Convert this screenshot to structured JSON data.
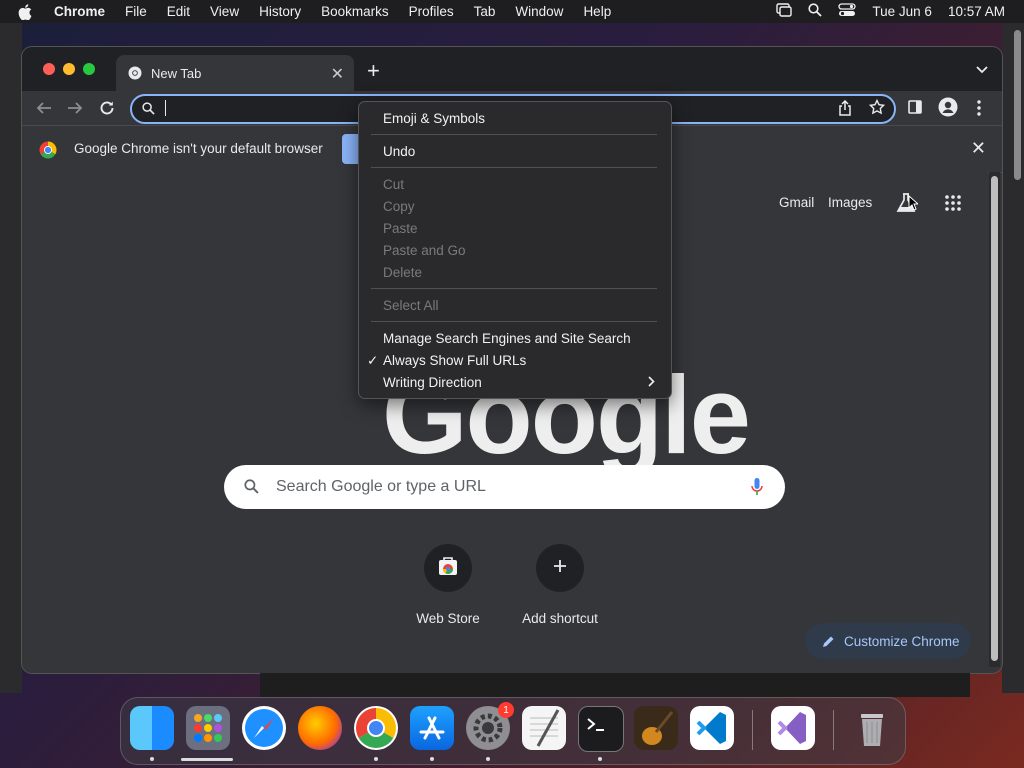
{
  "menubar": {
    "app_name": "Chrome",
    "items": [
      "File",
      "Edit",
      "View",
      "History",
      "Bookmarks",
      "Profiles",
      "Tab",
      "Window",
      "Help"
    ],
    "date": "Tue Jun 6",
    "time": "10:57 AM"
  },
  "tab": {
    "title": "New Tab"
  },
  "omnibox": {
    "value": ""
  },
  "infobar": {
    "message": "Google Chrome isn't your default browser"
  },
  "ntp": {
    "links": [
      "Gmail",
      "Images"
    ],
    "logo_text": "Google",
    "search_placeholder": "Search Google or type a URL",
    "shortcuts": [
      {
        "label": "Web Store"
      },
      {
        "label": "Add shortcut"
      }
    ],
    "customize_label": "Customize Chrome"
  },
  "context_menu": {
    "items": [
      {
        "label": "Emoji & Symbols",
        "enabled": true
      },
      {
        "label": "Undo",
        "enabled": true
      },
      {
        "label": "Cut",
        "enabled": false
      },
      {
        "label": "Copy",
        "enabled": false
      },
      {
        "label": "Paste",
        "enabled": false
      },
      {
        "label": "Paste and Go",
        "enabled": false
      },
      {
        "label": "Delete",
        "enabled": false
      },
      {
        "label": "Select All",
        "enabled": false
      },
      {
        "label": "Manage Search Engines and Site Search",
        "enabled": true
      },
      {
        "label": "Always Show Full URLs",
        "enabled": true,
        "checked": true
      },
      {
        "label": "Writing Direction",
        "enabled": true,
        "submenu": true
      }
    ]
  },
  "dock": {
    "apps": [
      "finder-icon",
      "launchpad-icon",
      "safari-icon",
      "firefox-icon",
      "chrome-icon",
      "app-store-icon",
      "system-settings-icon",
      "textedit-icon",
      "terminal-icon",
      "garageband-icon",
      "vscode-icon",
      "visual-studio-icon",
      "trash-icon"
    ],
    "settings_badge": "1"
  },
  "colors": {
    "accent": "#8ab4f8",
    "window_bg": "#35363a",
    "tabstrip_bg": "#202124"
  }
}
